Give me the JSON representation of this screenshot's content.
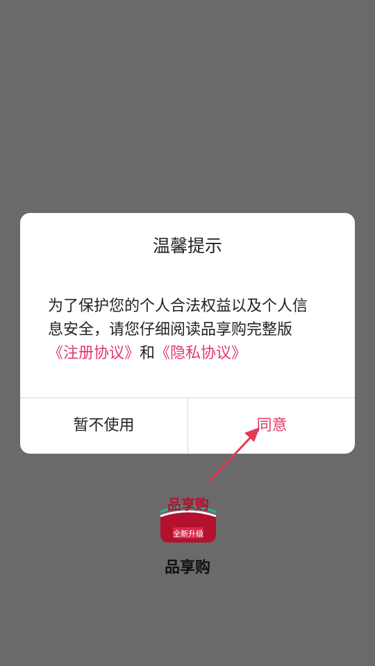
{
  "dialog": {
    "title": "温馨提示",
    "body_line1": "为了保护您的个人合法权益以及个人信",
    "body_line2": "息安全，请您仔细阅读品享购完整版",
    "link_register": "《注册协议》",
    "link_and": "和",
    "link_privacy": "《隐私协议》",
    "cancel_label": "暂不使用",
    "agree_label": "同意"
  },
  "app": {
    "icon_text_top": "品享购",
    "icon_text_badge": "全新升级",
    "name": "品享购"
  },
  "colors": {
    "overlay": "#6a6a6a",
    "accent": "#e03a6a",
    "dialog_bg": "#ffffff"
  }
}
